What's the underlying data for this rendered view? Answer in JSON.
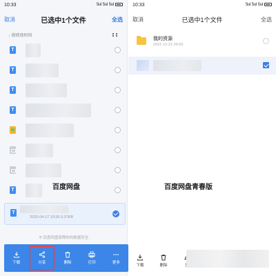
{
  "left": {
    "status": {
      "time": "10:33",
      "signal": "5ul 5ul 5ul",
      "battery": "battery"
    },
    "header": {
      "cancel": "取消",
      "title": "已选中1个文件",
      "select_all": "全选"
    },
    "sort_label": "按修改时间",
    "files": [
      {
        "icon": "doc-icon",
        "selected": false
      },
      {
        "icon": "doc-icon",
        "selected": false
      },
      {
        "icon": "doc-icon",
        "selected": false
      },
      {
        "icon": "doc-icon",
        "selected": false
      },
      {
        "icon": "image-icon",
        "selected": false
      },
      {
        "icon": "file-icon",
        "selected": false
      },
      {
        "icon": "file-icon",
        "selected": false
      },
      {
        "icon": "doc-icon",
        "selected": false
      }
    ],
    "selected_file": {
      "meta": "2020-04-17 19:26   0.37KB",
      "selected": true
    },
    "watermark": "百度网盘",
    "safe_note": "百度网盘保障你的数据安全",
    "toolbar": [
      {
        "label": "下载",
        "icon": "download-icon"
      },
      {
        "label": "分享",
        "icon": "share-icon",
        "highlight": true
      },
      {
        "label": "删除",
        "icon": "trash-icon"
      },
      {
        "label": "打印",
        "icon": "print-icon"
      },
      {
        "label": "更多",
        "icon": "more-icon"
      }
    ],
    "accent": "#3b7fe0",
    "highlight_color": "#e2464f"
  },
  "right": {
    "status": {
      "time": "10:33",
      "signal": "5ul 5ul 5ul",
      "battery": "battery"
    },
    "header": {
      "cancel": "取消",
      "title": "已选中1个文件",
      "select_all": "全选"
    },
    "folder": {
      "name": "我的资源",
      "date": "2021-12-21  09:56",
      "icon": "folder-icon"
    },
    "watermark": "百度网盘青春版",
    "toolbar": [
      {
        "label": "下载",
        "icon": "download-icon"
      },
      {
        "label": "删除",
        "icon": "trash-icon"
      },
      {
        "label": "重",
        "icon": "rename-icon"
      }
    ]
  }
}
